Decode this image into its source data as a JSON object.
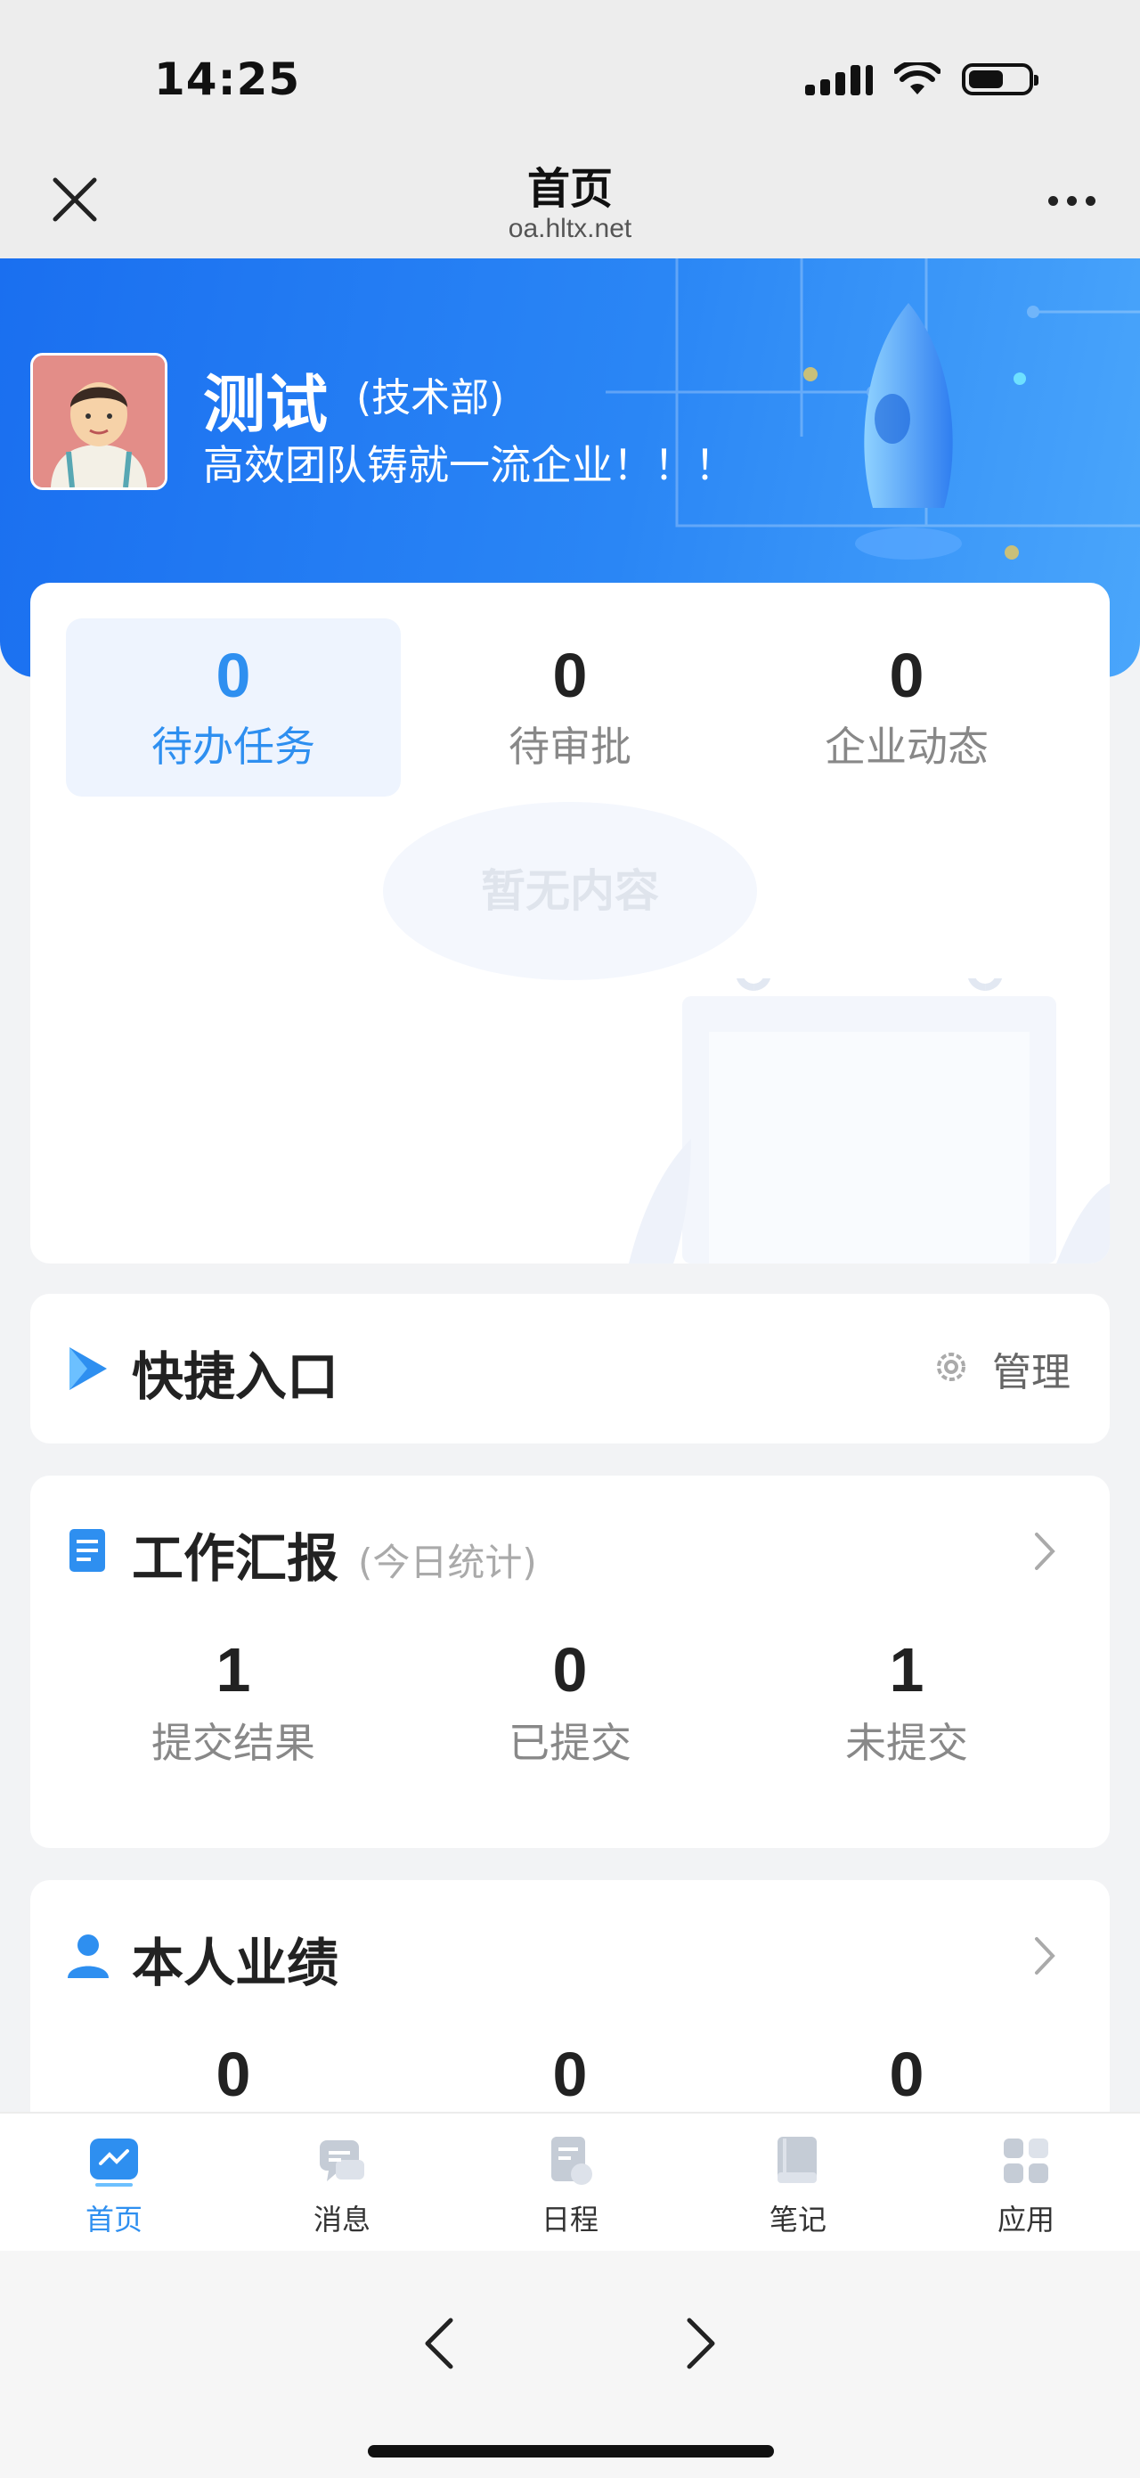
{
  "status_bar": {
    "time": "14:25"
  },
  "nav": {
    "title": "首页",
    "url": "oa.hltx.net"
  },
  "profile": {
    "name": "测试",
    "department": "(技术部)",
    "motto": "高效团队铸就一流企业！！！"
  },
  "stats": {
    "tabs": [
      {
        "value": "0",
        "label": "待办任务",
        "active": true
      },
      {
        "value": "0",
        "label": "待审批",
        "active": false
      },
      {
        "value": "0",
        "label": "企业动态",
        "active": false
      }
    ],
    "empty_text": "暂无内容"
  },
  "quick_entry": {
    "title": "快捷入口",
    "manage_label": "管理"
  },
  "work_report": {
    "title": "工作汇报",
    "subtitle": "(今日统计)",
    "metrics": [
      {
        "value": "1",
        "label": "提交结果"
      },
      {
        "value": "0",
        "label": "已提交"
      },
      {
        "value": "1",
        "label": "未提交"
      }
    ]
  },
  "performance": {
    "title": "本人业绩",
    "values": [
      "0",
      "0",
      "0"
    ]
  },
  "tab_bar": {
    "items": [
      {
        "label": "首页",
        "icon": "home-chart-icon",
        "active": true
      },
      {
        "label": "消息",
        "icon": "message-icon",
        "active": false
      },
      {
        "label": "日程",
        "icon": "schedule-icon",
        "active": false
      },
      {
        "label": "笔记",
        "icon": "notebook-icon",
        "active": false
      },
      {
        "label": "应用",
        "icon": "apps-grid-icon",
        "active": false
      }
    ]
  },
  "colors": {
    "primary": "#2e8ff0",
    "hero_start": "#1a6ff0",
    "hero_end": "#4aa6fb"
  }
}
